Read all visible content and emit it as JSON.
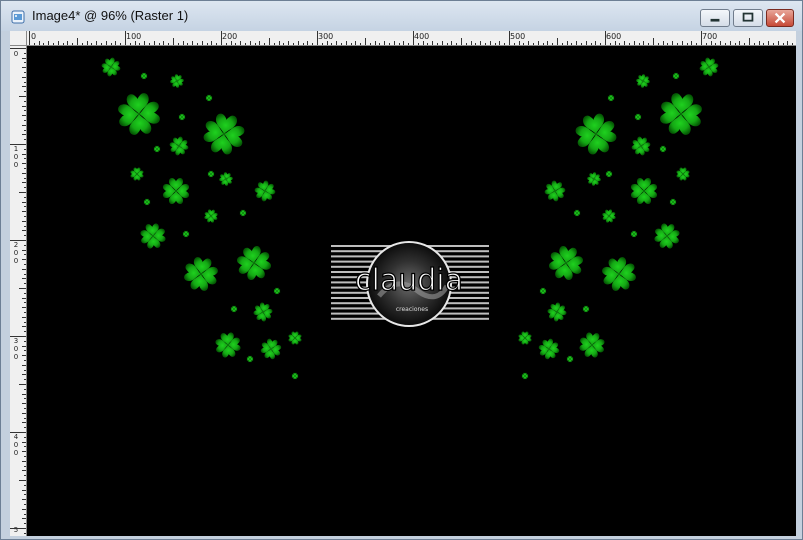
{
  "window": {
    "title": "Image4* @  96% (Raster 1)"
  },
  "ruler": {
    "top_labels": [
      "0",
      "100",
      "200",
      "300",
      "400",
      "500",
      "600",
      "700"
    ],
    "left_labels": [
      [
        "0"
      ],
      [
        "1",
        "0",
        "0"
      ],
      [
        "2",
        "0",
        "0"
      ],
      [
        "3",
        "0",
        "0"
      ],
      [
        "4",
        "0",
        "0"
      ],
      [
        "5"
      ]
    ]
  },
  "canvas": {
    "background": "#000000",
    "accent_green": "#1fb51f"
  },
  "logo": {
    "text": "claudia",
    "subtext": "creaciones"
  },
  "icons": {
    "app": "image-document-icon",
    "minimize": "minimize-icon",
    "maximize": "maximize-icon",
    "close": "close-icon"
  }
}
